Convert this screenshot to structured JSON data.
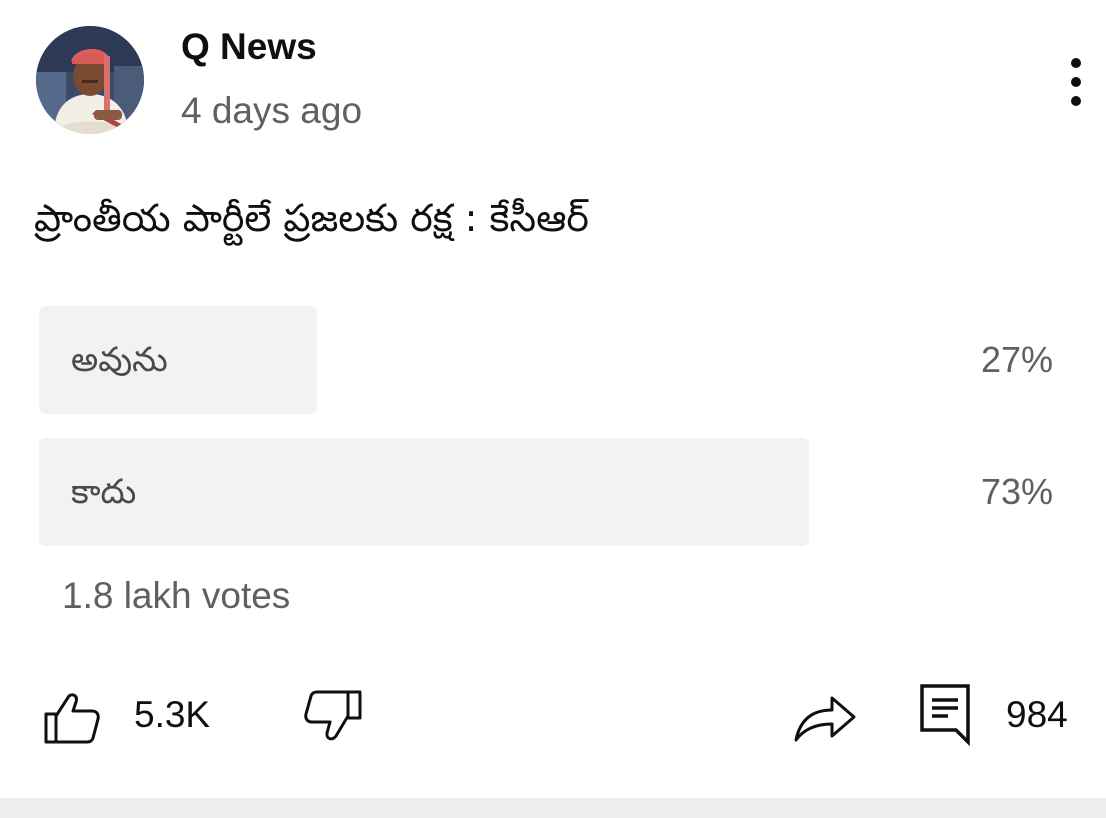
{
  "post": {
    "channel_name": "Q News",
    "time_ago": "4 days ago",
    "question": "ప్రాంతీయ పార్టీలే ప్రజలకు రక్ష : కేసీఆర్"
  },
  "poll": {
    "options": [
      {
        "label": "అవును",
        "percent_label": "27%",
        "percent": 27
      },
      {
        "label": "కాదు",
        "percent_label": "73%",
        "percent": 73
      }
    ],
    "votes": "1.8 lakh votes"
  },
  "actions": {
    "likes": "5.3K",
    "comments": "984"
  },
  "icons": {
    "avatar": "channel-avatar",
    "menu": "more-vertical-icon",
    "like": "thumb-up-icon",
    "dislike": "thumb-down-icon",
    "share": "share-arrow-icon",
    "comment": "comment-icon"
  },
  "colors": {
    "text_primary": "#0f0f0f",
    "text_secondary": "#606060",
    "poll_fill": "#f2f2f2",
    "bottom_strip": "#eeeeee"
  }
}
